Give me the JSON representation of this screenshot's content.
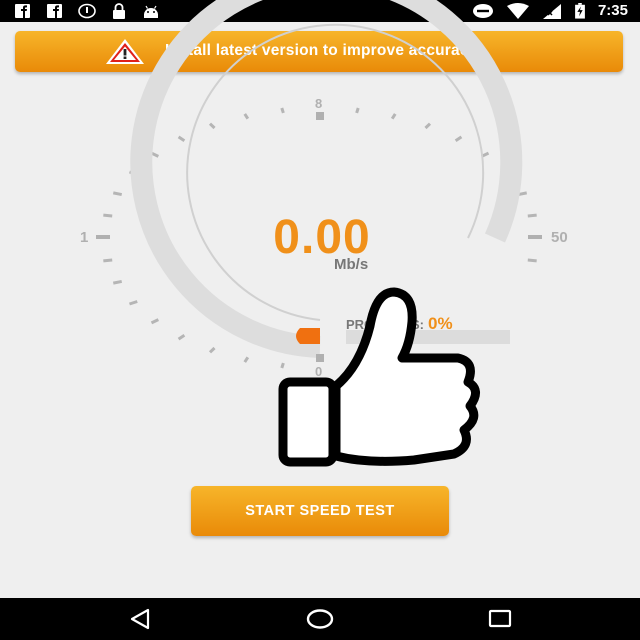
{
  "status_bar": {
    "time": "7:35",
    "left_icons": [
      "facebook-icon",
      "facebook-messenger-icon",
      "info-icon",
      "lock-icon",
      "android-icon"
    ],
    "right_icons": [
      "minus-circle-icon",
      "wifi-icon",
      "signal-icon",
      "battery-charging-icon"
    ]
  },
  "banner": {
    "icon": "warning-icon",
    "text": "Install latest version to improve accuracy",
    "color": "#f0901a"
  },
  "gauge": {
    "min_label": "1",
    "max_label": "50",
    "top_label": "8",
    "bottom_label": "0",
    "speed_value": "0.00",
    "speed_unit": "Mb/s",
    "accent_color": "#f0901a",
    "track_color": "#dcdcdc"
  },
  "progress": {
    "label": "PROGRESS:",
    "value": "0%",
    "fraction": 0
  },
  "overlay": {
    "icon": "thumbs-up-icon"
  },
  "start_button": {
    "label": "START SPEED TEST"
  },
  "nav_bar": {
    "icons": [
      "back-icon",
      "home-icon",
      "recents-icon"
    ]
  }
}
